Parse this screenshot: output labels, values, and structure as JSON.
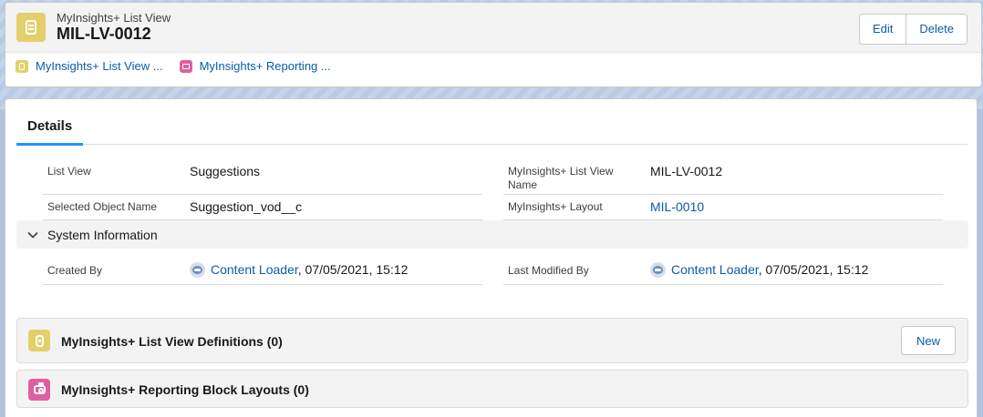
{
  "header": {
    "object_type": "MyInsights+ List View",
    "record_name": "MIL-LV-0012",
    "buttons": {
      "edit": "Edit",
      "delete": "Delete"
    },
    "related_links": [
      {
        "label": "MyInsights+ List View ...",
        "icon": "list-view-icon",
        "color": "#e3cf6c"
      },
      {
        "label": "MyInsights+ Reporting ...",
        "icon": "reporting-icon",
        "color": "#df5f9e"
      }
    ]
  },
  "tabs": {
    "details": "Details"
  },
  "fields": {
    "list_view": {
      "label": "List View",
      "value": "Suggestions"
    },
    "list_view_name": {
      "label": "MyInsights+ List View Name",
      "value": "MIL-LV-0012"
    },
    "selected_object": {
      "label": "Selected Object Name",
      "value": "Suggestion_vod__c"
    },
    "layout": {
      "label": "MyInsights+ Layout",
      "value": "MIL-0010"
    }
  },
  "system_info": {
    "title": "System Information",
    "created_by": {
      "label": "Created By",
      "user": "Content Loader",
      "date": ", 07/05/2021, 15:12"
    },
    "last_modified_by": {
      "label": "Last Modified By",
      "user": "Content Loader",
      "date": ", 07/05/2021, 15:12"
    }
  },
  "related_lists": [
    {
      "title": "MyInsights+ List View Definitions (0)",
      "new_label": "New",
      "icon": "list-view-icon"
    },
    {
      "title": "MyInsights+ Reporting Block Layouts (0)",
      "icon": "reporting-icon"
    }
  ],
  "colors": {
    "accent": "#1b96ff",
    "link": "#0b5cab",
    "list_view_icon": "#e3cf6c",
    "reporting_icon": "#df5f9e"
  }
}
